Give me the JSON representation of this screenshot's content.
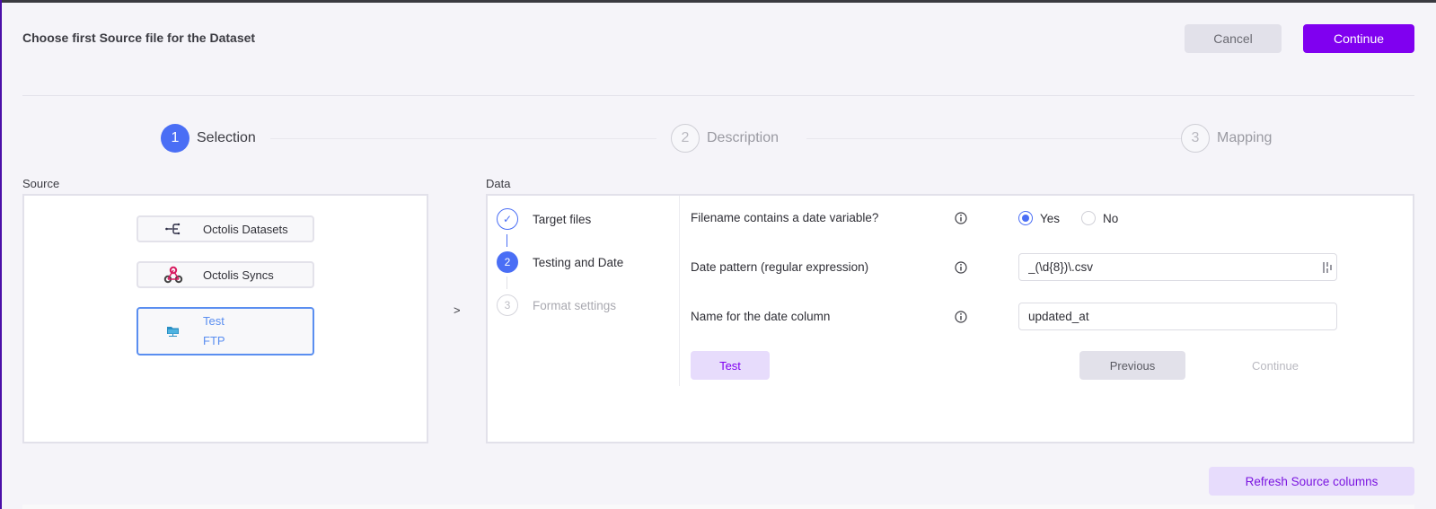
{
  "header": {
    "title": "Choose first Source file for the Dataset",
    "cancel_label": "Cancel",
    "continue_label": "Continue"
  },
  "stepper": [
    {
      "number": "1",
      "label": "Selection",
      "state": "active"
    },
    {
      "number": "2",
      "label": "Description",
      "state": "inactive"
    },
    {
      "number": "3",
      "label": "Mapping",
      "state": "inactive"
    }
  ],
  "source": {
    "label": "Source",
    "items": [
      {
        "label": "Octolis Datasets",
        "icon": "dataset-branch-icon",
        "selected": false
      },
      {
        "label": "Octolis Syncs",
        "icon": "webhook-icon",
        "selected": false
      },
      {
        "label_line1": "Test",
        "label_line2": "FTP",
        "icon": "ftp-folder-icon",
        "selected": true
      }
    ]
  },
  "arrow": ">",
  "data": {
    "label": "Data",
    "substeps": [
      {
        "number": "✓",
        "label": "Target files",
        "state": "done"
      },
      {
        "number": "2",
        "label": "Testing and Date",
        "state": "current"
      },
      {
        "number": "3",
        "label": "Format settings",
        "state": "pending"
      }
    ],
    "fields": {
      "date_variable": {
        "label": "Filename contains a date variable?",
        "options": [
          "Yes",
          "No"
        ],
        "selected": "Yes"
      },
      "date_pattern": {
        "label": "Date pattern (regular expression)",
        "value": "_(\\d{8})\\.csv"
      },
      "date_column": {
        "label": "Name for the date column",
        "value": "updated_at"
      }
    },
    "buttons": {
      "test_label": "Test",
      "previous_label": "Previous",
      "continue_label": "Continue"
    }
  },
  "footer": {
    "refresh_label": "Refresh Source columns"
  },
  "colors": {
    "primary": "#8000f0",
    "step_active": "#4a6ef5",
    "selected_border": "#5a8ef0"
  }
}
